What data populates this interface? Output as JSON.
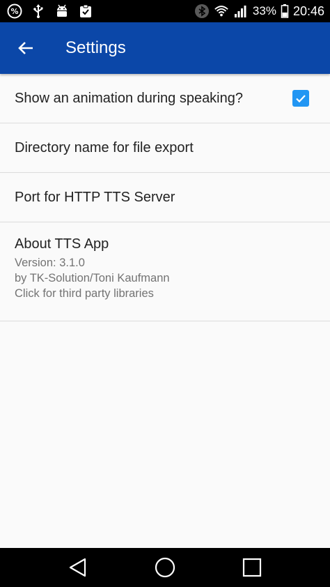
{
  "status_bar": {
    "battery": "33%",
    "time": "20:46",
    "left_icons": [
      "percent-icon",
      "usb-icon",
      "android-debug-icon",
      "clipboard-check-icon"
    ],
    "right_icons": [
      "bluetooth-icon",
      "wifi-icon",
      "signal-icon",
      "battery-icon"
    ]
  },
  "app_bar": {
    "title": "Settings",
    "back_icon": "arrow-back-icon",
    "color": "#0b47a8"
  },
  "settings": {
    "animation": {
      "title": "Show an animation during speaking?",
      "checked": true,
      "accent": "#2196f3"
    },
    "directory": {
      "title": "Directory name for file export"
    },
    "port": {
      "title": "Port for HTTP TTS Server"
    },
    "about": {
      "title": "About TTS App",
      "version": "Version: 3.1.0",
      "author": "by TK-Solution/Toni Kaufmann",
      "libraries": "Click for third party libraries"
    }
  },
  "nav_bar": {
    "icons": [
      "back-triangle-icon",
      "home-circle-icon",
      "recents-square-icon"
    ]
  }
}
